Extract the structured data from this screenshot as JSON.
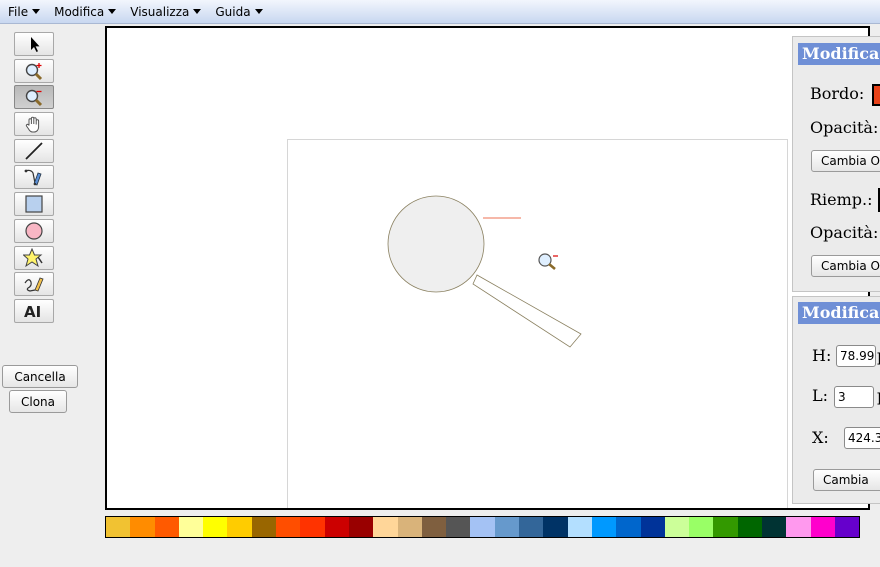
{
  "menu": {
    "items": [
      {
        "label": "File"
      },
      {
        "label": "Modifica"
      },
      {
        "label": "Visualizza"
      },
      {
        "label": "Guida"
      }
    ]
  },
  "tools": [
    {
      "name": "select-tool",
      "icon": "arrow-pointer-icon"
    },
    {
      "name": "zoom-in-tool",
      "icon": "zoom-in-icon"
    },
    {
      "name": "zoom-out-tool",
      "icon": "zoom-out-icon",
      "active": true
    },
    {
      "name": "pan-tool",
      "icon": "hand-icon"
    },
    {
      "name": "line-tool",
      "icon": "line-icon"
    },
    {
      "name": "pen-tool",
      "icon": "pen-icon"
    },
    {
      "name": "rectangle-tool",
      "icon": "rectangle-icon"
    },
    {
      "name": "ellipse-tool",
      "icon": "ellipse-icon"
    },
    {
      "name": "star-tool",
      "icon": "star-icon"
    },
    {
      "name": "freehand-tool",
      "icon": "freehand-icon"
    },
    {
      "name": "text-tool",
      "icon": "text-icon",
      "label": "AI"
    }
  ],
  "actions": {
    "delete_label": "Cancella",
    "clone_label": "Clona"
  },
  "style_panel": {
    "title": "Modifica",
    "border_label": "Bordo:",
    "border_color": "#e8431a",
    "border_opacity_label": "Opacità:",
    "border_change_label": "Cambia O",
    "fill_label": "Riemp.:",
    "fill_opacity_label": "Opacità:",
    "fill_change_label": "Cambia O"
  },
  "geometry_panel": {
    "title": "Modifica",
    "h_label": "H:",
    "h_value": "78.99",
    "h_unit": "p",
    "w_label": "L:",
    "w_value": "3",
    "w_unit": "p",
    "x_label": "X:",
    "x_value": "424.3",
    "apply_label": "Cambia"
  },
  "palette": {
    "colors": [
      "#f1c232",
      "#ff8c00",
      "#ff5a00",
      "#ffff99",
      "#ffff00",
      "#ffcc00",
      "#996600",
      "#ff4e00",
      "#ff3300",
      "#cc0000",
      "#990000",
      "#ffd699",
      "#d9b37a",
      "#7f5f3f",
      "#555555",
      "#a4c2f4",
      "#6699cc",
      "#336699",
      "#003366",
      "#b3dfff",
      "#0099ff",
      "#0066cc",
      "#003399",
      "#ccff99",
      "#99ff66",
      "#339900",
      "#006600",
      "#003333",
      "#ff99ee",
      "#ff00cc",
      "#6600cc"
    ]
  }
}
